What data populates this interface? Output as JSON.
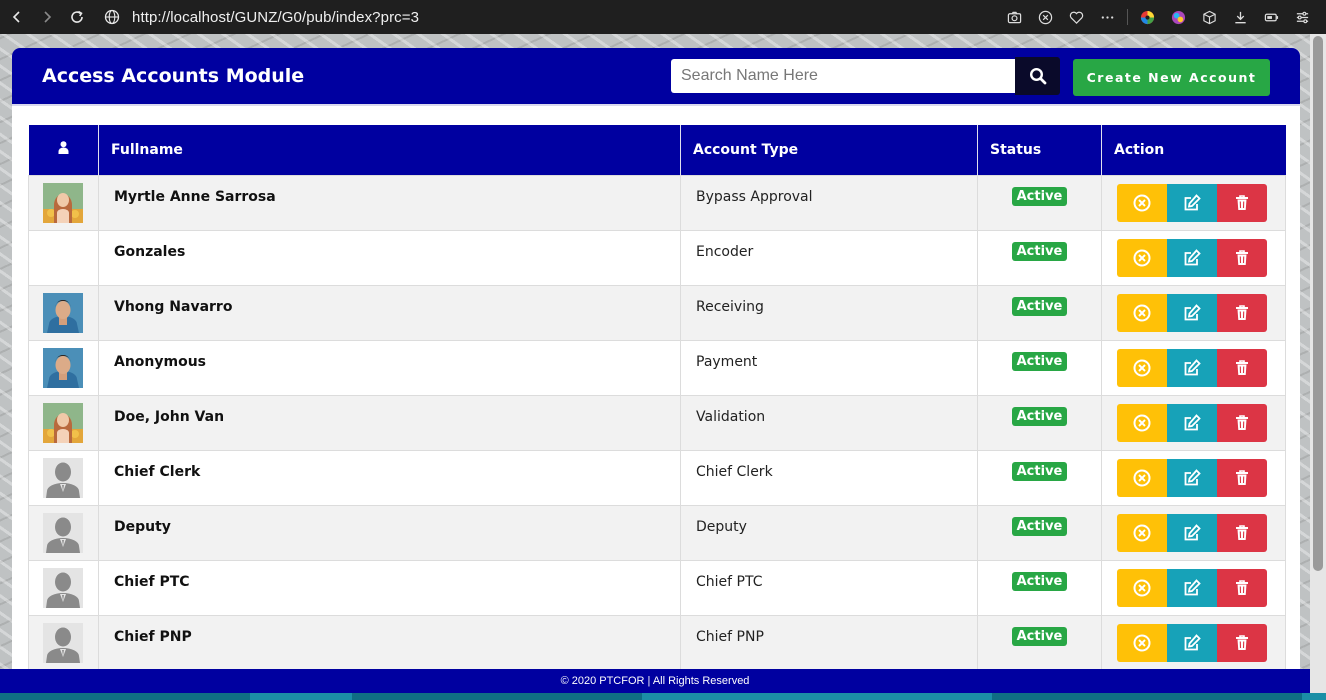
{
  "browser": {
    "url": "http://localhost/GUNZ/G0/pub/index?prc=3"
  },
  "header": {
    "title": "Access Accounts Module",
    "search_placeholder": "Search Name Here",
    "create_label": "Create New Account"
  },
  "table": {
    "columns": [
      "Fullname",
      "Account Type",
      "Status",
      "Action"
    ],
    "rows": [
      {
        "name": "Myrtle Anne Sarrosa",
        "type": "Bypass Approval",
        "status": "Active",
        "avatar": "photo-female"
      },
      {
        "name": "Gonzales",
        "type": "Encoder",
        "status": "Active",
        "avatar": "none"
      },
      {
        "name": "Vhong Navarro",
        "type": "Receiving",
        "status": "Active",
        "avatar": "photo-male"
      },
      {
        "name": "Anonymous",
        "type": "Payment",
        "status": "Active",
        "avatar": "photo-male"
      },
      {
        "name": "Doe, John Van",
        "type": "Validation",
        "status": "Active",
        "avatar": "photo-female"
      },
      {
        "name": "Chief Clerk",
        "type": "Chief Clerk",
        "status": "Active",
        "avatar": "silhouette"
      },
      {
        "name": "Deputy",
        "type": "Deputy",
        "status": "Active",
        "avatar": "silhouette"
      },
      {
        "name": "Chief PTC",
        "type": "Chief PTC",
        "status": "Active",
        "avatar": "silhouette"
      },
      {
        "name": "Chief PNP",
        "type": "Chief PNP",
        "status": "Active",
        "avatar": "silhouette"
      }
    ]
  },
  "footer": {
    "text": "© 2020 PTCFOR | All Rights Reserved"
  },
  "colors": {
    "primary": "#0000a0",
    "success": "#28a745",
    "warning": "#ffc107",
    "info": "#17a2b8",
    "danger": "#dc3545"
  }
}
